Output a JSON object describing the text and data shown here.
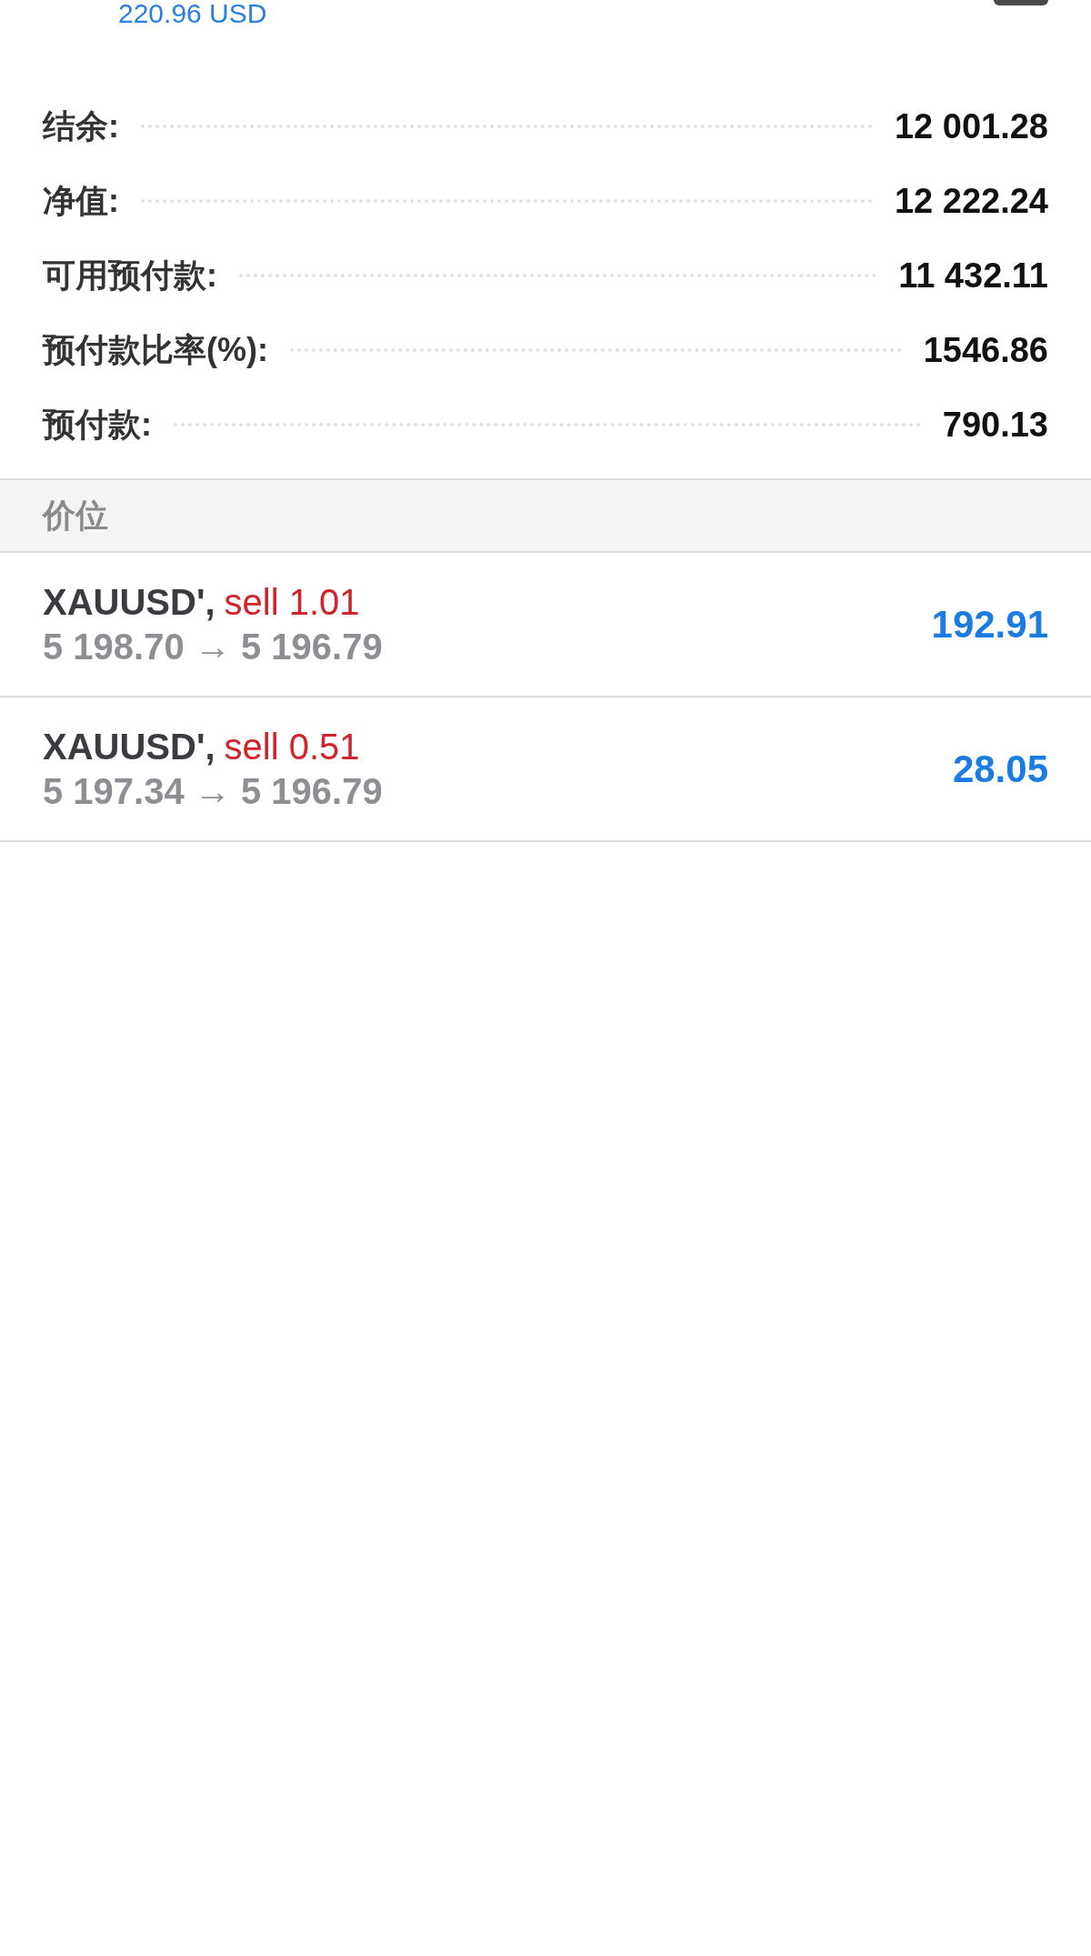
{
  "header_amount": "220.96 USD",
  "summary": [
    {
      "label": "结余:",
      "value": "12 001.28"
    },
    {
      "label": "净值:",
      "value": "12 222.24"
    },
    {
      "label": "可用预付款:",
      "value": "11 432.11"
    },
    {
      "label": "预付款比率(%):",
      "value": "1546.86"
    },
    {
      "label": "预付款:",
      "value": "790.13"
    }
  ],
  "section_title": "价位",
  "positions": [
    {
      "symbol": "XAUUSD',",
      "order": "sell 1.01",
      "prices": "5 198.70 → 5 196.79",
      "profit": "192.91"
    },
    {
      "symbol": "XAUUSD',",
      "order": "sell 0.51",
      "prices": "5 197.34 → 5 196.79",
      "profit": "28.05"
    }
  ]
}
